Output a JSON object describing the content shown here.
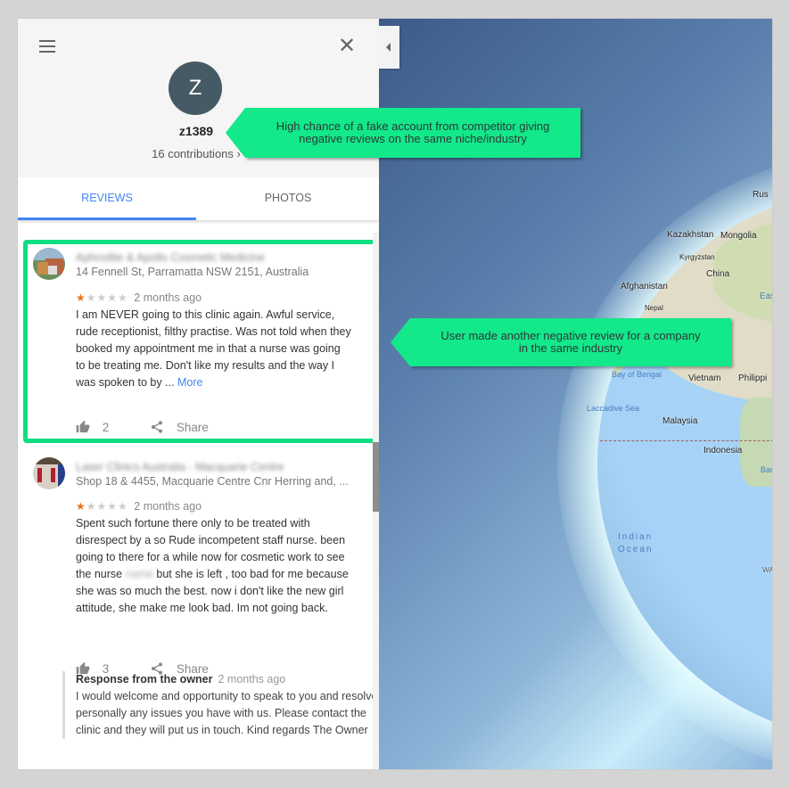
{
  "profile": {
    "avatar_letter": "Z",
    "username": "z1389",
    "contributions": "16 contributions",
    "contributions_chevron": "›",
    "close_glyph": "✕"
  },
  "tabs": [
    {
      "label": "REVIEWS",
      "active": true
    },
    {
      "label": "PHOTOS",
      "active": false
    }
  ],
  "reviews": [
    {
      "place_name": "Aphrodite & Apollo Cosmetic Medicine",
      "place_name_blurred": true,
      "address": "14 Fennell St, Parramatta NSW 2151, Australia",
      "rating": 1,
      "rating_max": 5,
      "time": "2 months ago",
      "text": "I am NEVER going to this clinic again. Awful service, rude receptionist, filthy practise. Was not told when they booked my appointment me in that a nurse was going to be treating me. Don't like my results and the way I was spoken to by ...",
      "more_label": "More",
      "likes": "2",
      "share_label": "Share"
    },
    {
      "place_name": "Laser Clinics Australia - Macquarie Centre",
      "place_name_blurred": true,
      "address": "Shop 18 & 4455, Macquarie Centre Cnr Herring and, ...",
      "rating": 1,
      "rating_max": 5,
      "time": "2 months ago",
      "text_before_blur": "Spent such fortune there only to be treated with disrespect by a so Rude incompetent staff nurse. been going to there for a while now for cosmetic work to see the nurse",
      "blurred_name": "name",
      "text_after_blur": "but she is left , too bad for me because she was so much the best. now i don't like the new girl attitude, she make me look bad. Im not going back.",
      "likes": "3",
      "share_label": "Share",
      "owner_response": {
        "heading": "Response from the owner",
        "time": "2 months ago",
        "text": "I would welcome and opportunity to speak to you and resolve personally any issues you have with us. Please contact the clinic and they will put us in touch. Kind regards The Owner"
      }
    }
  ],
  "annotations": {
    "callout_1": "High chance of a fake account from competitor giving negative reviews on the same niche/industry",
    "callout_2": "User made another negative review for a company in the same industry",
    "highlight_color": "#0dde82",
    "callout_color": "#13e88b"
  },
  "map": {
    "labels": {
      "russia": "Rus",
      "kazakhstan": "Kazakhstan",
      "mongolia": "Mongolia",
      "kyrgyzstan": "Kyrgyzstan",
      "china": "China",
      "afghanistan": "Afghanistan",
      "nepal": "Nepal",
      "east": "Eas",
      "bay_of_bengal": "Bay of Bengal",
      "vietnam": "Vietnam",
      "philippines": "Philippi",
      "laccadive_sea": "Laccadive Sea",
      "malaysia": "Malaysia",
      "indonesia": "Indonesia",
      "banda": "Ban",
      "indian_ocean_1": "Indian",
      "indian_ocean_2": "Ocean",
      "wa": "WA"
    }
  },
  "colors": {
    "accent": "#4285f4",
    "star_on": "#e7711b",
    "avatar_bg": "#455a64"
  }
}
